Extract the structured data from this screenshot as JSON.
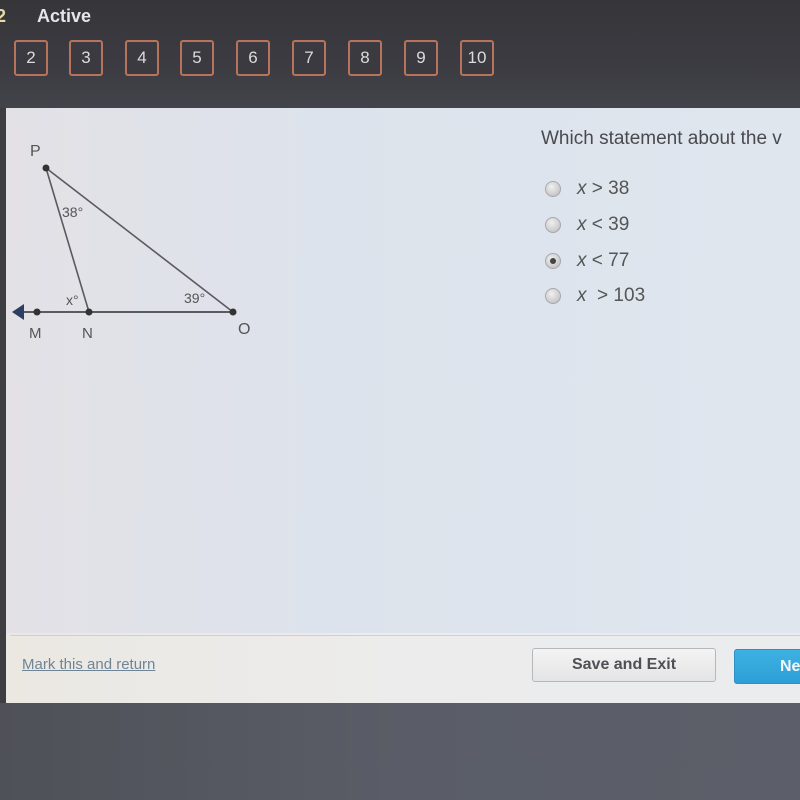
{
  "header": {
    "cut_number": "2",
    "status": "Active",
    "question_nav": [
      "2",
      "3",
      "4",
      "5",
      "6",
      "7",
      "8",
      "9",
      "10"
    ]
  },
  "diagram": {
    "points": {
      "P": "P",
      "M": "M",
      "N": "N",
      "O": "O"
    },
    "angle_labels": {
      "at_P": "38°",
      "at_N": "x°",
      "at_O": "39°"
    },
    "arrow": "left-arrow"
  },
  "question": {
    "text": "Which statement about the v",
    "options": [
      {
        "var": "x",
        "rest": " > 38",
        "selected": false
      },
      {
        "var": "x",
        "rest": " < 39",
        "selected": false
      },
      {
        "var": "x",
        "rest": " < 77",
        "selected": true
      },
      {
        "var": "x",
        "rest": "  > 103",
        "selected": false
      }
    ]
  },
  "footer": {
    "mark_link": "Mark this and return",
    "save_label": "Save and Exit",
    "next_label": "Ne"
  },
  "colors": {
    "nav_border": "#b8735c",
    "next_button": "#2c9fd6",
    "link": "#6f8596"
  }
}
